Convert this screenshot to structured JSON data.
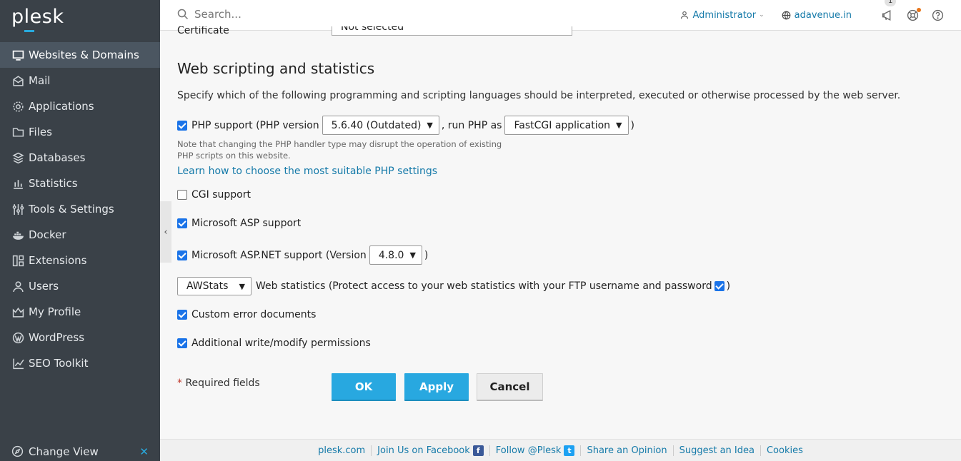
{
  "brand": {
    "logo_text": "plesk"
  },
  "sidebar": {
    "items": [
      {
        "label": "Websites & Domains",
        "icon": "monitor-icon",
        "active": true
      },
      {
        "label": "Mail",
        "icon": "mail-icon"
      },
      {
        "label": "Applications",
        "icon": "gear-icon"
      },
      {
        "label": "Files",
        "icon": "folder-icon"
      },
      {
        "label": "Databases",
        "icon": "database-icon"
      },
      {
        "label": "Statistics",
        "icon": "bar-chart-icon"
      },
      {
        "label": "Tools & Settings",
        "icon": "sliders-icon"
      },
      {
        "label": "Docker",
        "icon": "docker-icon"
      },
      {
        "label": "Extensions",
        "icon": "extensions-icon"
      },
      {
        "label": "Users",
        "icon": "user-icon"
      },
      {
        "label": "My Profile",
        "icon": "profile-icon"
      },
      {
        "label": "WordPress",
        "icon": "wordpress-icon"
      },
      {
        "label": "SEO Toolkit",
        "icon": "seo-icon"
      }
    ],
    "change_view": "Change View",
    "close_glyph": "✕"
  },
  "topbar": {
    "search_placeholder": "Search...",
    "user": "Administrator",
    "domain": "adavenue.in",
    "notification_count": "1"
  },
  "form": {
    "certificate_label": "Certificate",
    "certificate_value": "Not selected",
    "section_title": "Web scripting and statistics",
    "description": "Specify which of the following programming and scripting languages should be interpreted, executed or otherwise processed by the web server.",
    "php": {
      "checked": true,
      "label_prefix": "PHP support (PHP version",
      "version": "5.6.40 (Outdated)",
      "run_as_text": ", run PHP as",
      "handler": "FastCGI application",
      "suffix": ")",
      "note": "Note that changing the PHP handler type may disrupt the operation of existing PHP scripts on this website.",
      "link": "Learn how to choose the most suitable PHP settings"
    },
    "cgi": {
      "checked": false,
      "label": "CGI support"
    },
    "asp": {
      "checked": true,
      "label": "Microsoft ASP support"
    },
    "aspnet": {
      "checked": true,
      "label_prefix": "Microsoft ASP.NET support (Version",
      "version": "4.8.0",
      "suffix": ")"
    },
    "stats": {
      "tool": "AWStats",
      "label": "Web statistics (Protect access to your web statistics with your FTP username and password",
      "protect_checked": true,
      "suffix": ")"
    },
    "custom_errors": {
      "checked": true,
      "label": "Custom error documents"
    },
    "permissions": {
      "checked": true,
      "label": "Additional write/modify permissions"
    },
    "required_star": "*",
    "required_text": "Required fields",
    "ok": "OK",
    "apply": "Apply",
    "cancel": "Cancel"
  },
  "footer": {
    "links": [
      "plesk.com",
      "Join Us on Facebook",
      "Follow @Plesk",
      "Share an Opinion",
      "Suggest an Idea",
      "Cookies"
    ]
  },
  "colors": {
    "sidebar_bg": "#3a4148",
    "accent": "#28a8e0",
    "link": "#157aa9"
  }
}
